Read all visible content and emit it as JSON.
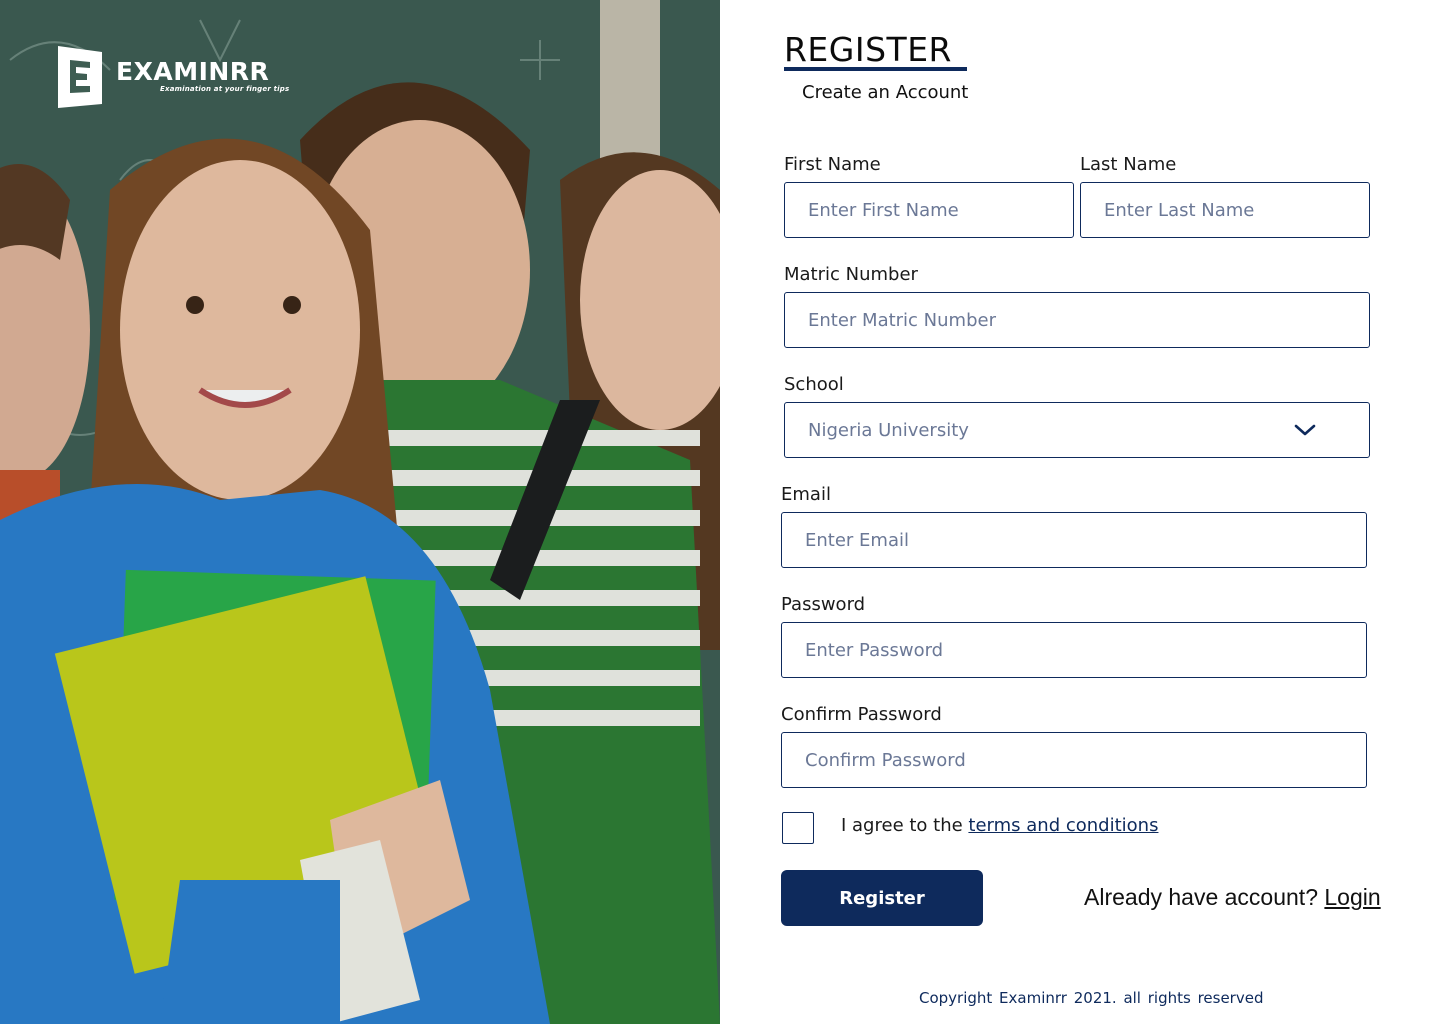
{
  "brand": {
    "name": "EXAMINRR",
    "tagline": "Examination at your finger tips"
  },
  "form": {
    "title": "REGISTER",
    "subtitle": "Create an Account",
    "first_name": {
      "label": "First Name",
      "placeholder": "Enter First Name"
    },
    "last_name": {
      "label": "Last Name",
      "placeholder": "Enter Last Name"
    },
    "matric_number": {
      "label": "Matric Number",
      "placeholder": "Enter Matric Number"
    },
    "school": {
      "label": "School",
      "selected": "Nigeria University"
    },
    "email": {
      "label": "Email",
      "placeholder": "Enter Email"
    },
    "password": {
      "label": "Password",
      "placeholder": "Enter Password"
    },
    "confirm_password": {
      "label": "Confirm Password",
      "placeholder": "Confirm Password"
    },
    "agree_prefix": "I agree to the ",
    "terms_link": "terms and conditions",
    "register_label": "Register",
    "have_account_prefix": "Already have account? ",
    "login_link": "Login"
  },
  "footer": {
    "copyright": "Copyright   Examinrr 2021.   all rights reserved"
  },
  "colors": {
    "brand_navy": "#0e2a5c",
    "placeholder": "#6b7896"
  },
  "icons": {
    "logo": "examinrr-e-logo-icon",
    "select_arrow": "chevron-down-icon"
  }
}
